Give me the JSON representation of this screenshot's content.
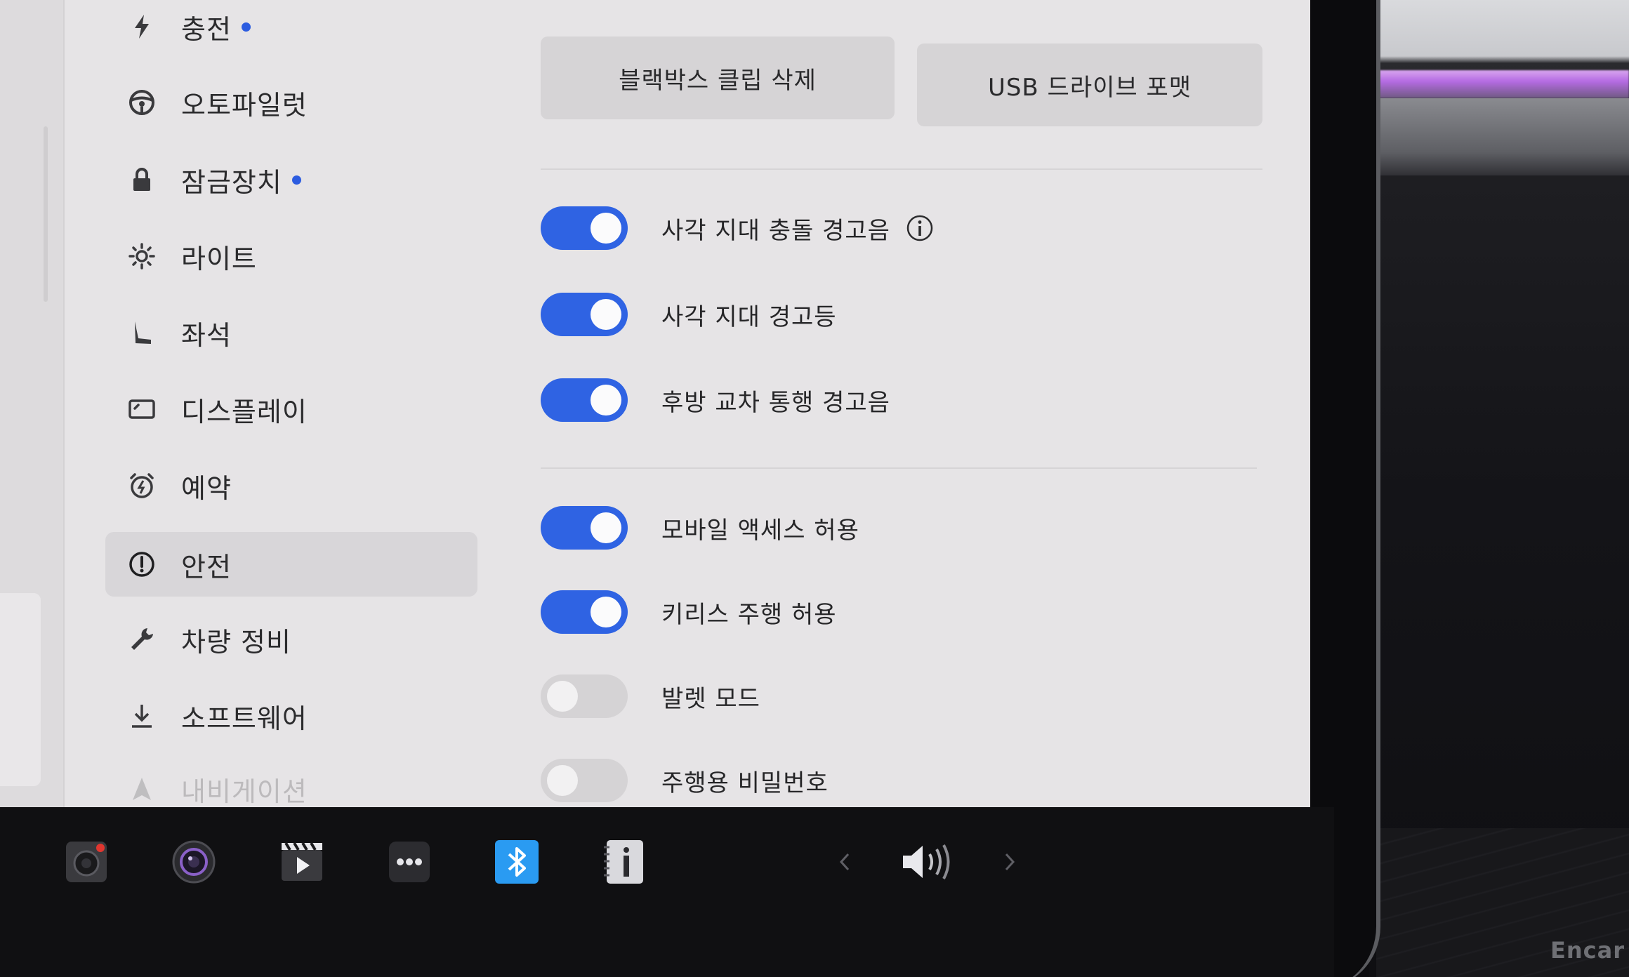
{
  "sidebar": {
    "items": [
      {
        "label": "충전",
        "icon": "lightning-icon",
        "dot": true
      },
      {
        "label": "오토파일럿",
        "icon": "steering-wheel-icon",
        "dot": false
      },
      {
        "label": "잠금장치",
        "icon": "lock-icon",
        "dot": true
      },
      {
        "label": "라이트",
        "icon": "sun-icon",
        "dot": false
      },
      {
        "label": "좌석",
        "icon": "seat-icon",
        "dot": false
      },
      {
        "label": "디스플레이",
        "icon": "display-icon",
        "dot": false
      },
      {
        "label": "예약",
        "icon": "alarm-clock-icon",
        "dot": false
      },
      {
        "label": "안전",
        "icon": "alert-circle-icon",
        "dot": false,
        "selected": true
      },
      {
        "label": "차량 정비",
        "icon": "wrench-icon",
        "dot": false
      },
      {
        "label": "소프트웨어",
        "icon": "download-icon",
        "dot": false
      },
      {
        "label": "내비게이션",
        "icon": "navigation-arrow-icon",
        "dot": false
      }
    ],
    "notification_dot_color": "#2c5ce0"
  },
  "main": {
    "buttons": {
      "delete_dashcam": "블랙박스 클립 삭제",
      "format_usb": "USB 드라이브 포맷"
    },
    "toggles_group1": [
      {
        "label": "사각 지대 충돌 경고음",
        "on": true,
        "info": true
      },
      {
        "label": "사각 지대 경고등",
        "on": true
      },
      {
        "label": "후방 교차 통행 경고음",
        "on": true
      }
    ],
    "toggles_group2": [
      {
        "label": "모바일 액세스 허용",
        "on": true
      },
      {
        "label": "키리스 주행 허용",
        "on": true
      },
      {
        "label": "발렛 모드",
        "on": false
      },
      {
        "label": "주행용 비밀번호",
        "on": false
      }
    ],
    "accent_color": "#2f63e3"
  },
  "dock": {
    "icons": [
      "dashcam-icon",
      "camera-lens-icon",
      "video-player-icon",
      "more-icon",
      "bluetooth-icon",
      "manual-info-icon",
      "chevron-left-icon",
      "volume-icon",
      "chevron-right-icon"
    ]
  },
  "watermark": "Encar"
}
